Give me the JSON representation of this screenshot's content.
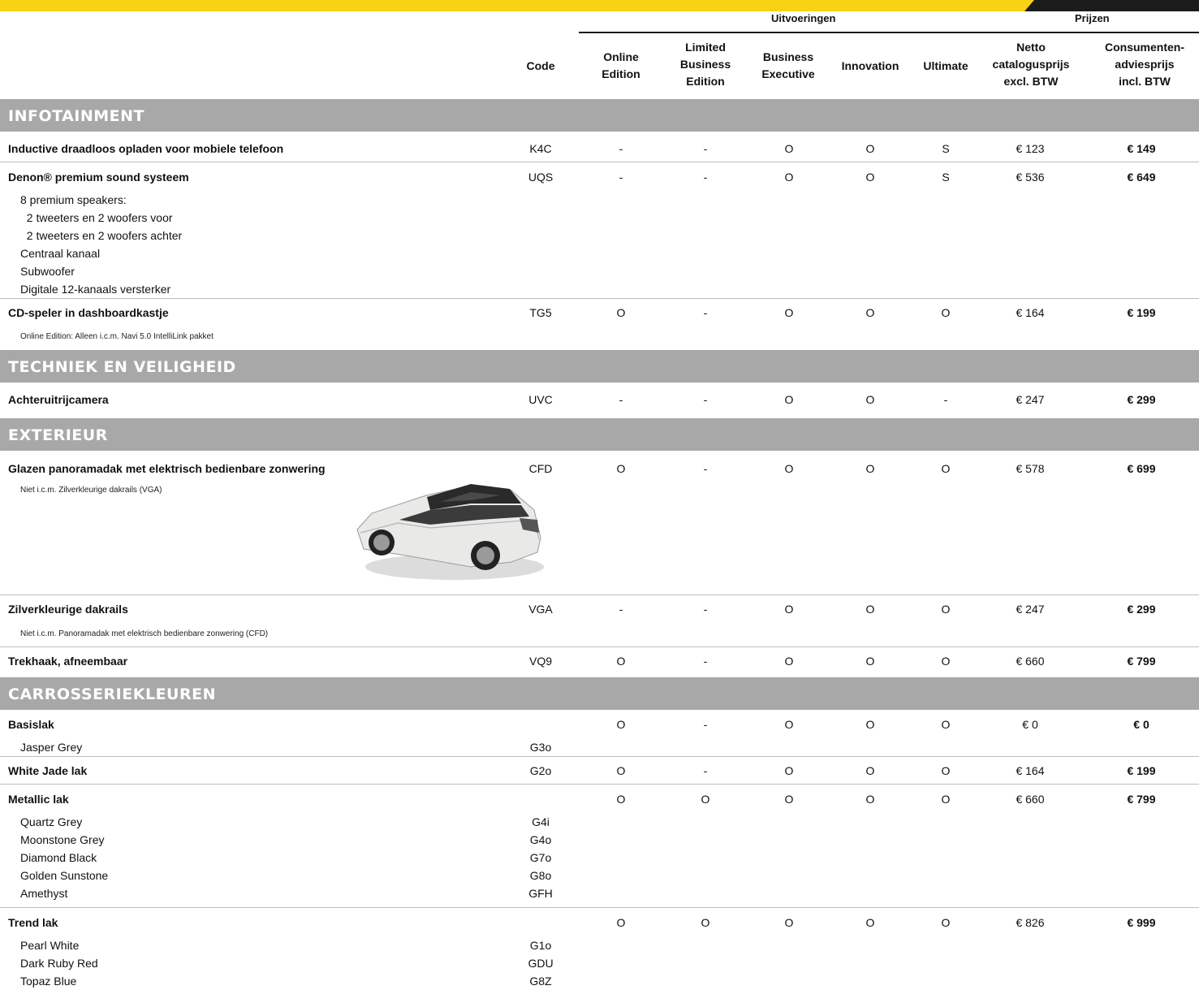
{
  "header": {
    "group_variants": "Uitvoeringen",
    "group_prices": "Prijzen",
    "columns": {
      "code": "Code",
      "online": "Online\nEdition",
      "limited": "Limited\nBusiness\nEdition",
      "business": "Business\nExecutive",
      "innovation": "Innovation",
      "ultimate": "Ultimate",
      "netto": "Netto\ncataloguspr­ijs\nexcl. BTW",
      "consumer": "Consumenten-\nadviesprijs\nincl. BTW"
    }
  },
  "sections": {
    "infotainment": "INFOTAINMENT",
    "techniek": "TECHNIEK EN VEILIGHEID",
    "exterieur": "EXTERIEUR",
    "carrosserie": "CARROSSERIEKLEUREN"
  },
  "rows": {
    "r1": {
      "label": "Inductive draadloos opladen voor mobiele telefoon",
      "code": "K4C",
      "v": [
        "-",
        "-",
        "O",
        "O",
        "S"
      ],
      "netto": "€ 123",
      "consumer": "€ 149"
    },
    "r2": {
      "label": "Denon® premium sound systeem",
      "code": "UQS",
      "v": [
        "-",
        "-",
        "O",
        "O",
        "S"
      ],
      "netto": "€ 536",
      "consumer": "€ 649",
      "sub": "8 premium speakers:\n  2 tweeters en 2 woofers voor\n  2 tweeters en 2 woofers achter\nCentraal kanaal\nSubwoofer\nDigitale 12-kanaals versterker"
    },
    "r3": {
      "label": "CD-speler in dashboardkastje",
      "code": "TG5",
      "v": [
        "O",
        "-",
        "O",
        "O",
        "O"
      ],
      "netto": "€ 164",
      "consumer": "€ 199",
      "note": "Online Edition: Alleen i.c.m. Navi 5.0 IntelliLink pakket"
    },
    "r4": {
      "label": "Achteruitrijcamera",
      "code": "UVC",
      "v": [
        "-",
        "-",
        "O",
        "O",
        "-"
      ],
      "netto": "€ 247",
      "consumer": "€ 299"
    },
    "r5": {
      "label": "Glazen panoramadak met elektrisch bedienbare zonwering",
      "code": "CFD",
      "v": [
        "O",
        "-",
        "O",
        "O",
        "O"
      ],
      "netto": "€ 578",
      "consumer": "€ 699",
      "note": "Niet i.c.m. Zilverkleurige dakrails (VGA)"
    },
    "r6": {
      "label": "Zilverkleurige dakrails",
      "code": "VGA",
      "v": [
        "-",
        "-",
        "O",
        "O",
        "O"
      ],
      "netto": "€ 247",
      "consumer": "€ 299",
      "note": "Niet i.c.m. Panoramadak met elektrisch bedienbare zonwering (CFD)"
    },
    "r7": {
      "label": "Trekhaak, afneembaar",
      "code": "VQ9",
      "v": [
        "O",
        "-",
        "O",
        "O",
        "O"
      ],
      "netto": "€ 660",
      "consumer": "€ 799"
    },
    "r8": {
      "label": "Basislak",
      "code": "",
      "v": [
        "O",
        "-",
        "O",
        "O",
        "O"
      ],
      "netto": "€ 0",
      "consumer": "€ 0",
      "sub": "Jasper Grey",
      "subcode": "G3o"
    },
    "r9": {
      "label": "White Jade lak",
      "code": "G2o",
      "v": [
        "O",
        "-",
        "O",
        "O",
        "O"
      ],
      "netto": "€ 164",
      "consumer": "€ 199"
    },
    "r10": {
      "label": "Metallic lak",
      "code": "",
      "v": [
        "O",
        "O",
        "O",
        "O",
        "O"
      ],
      "netto": "€ 660",
      "consumer": "€ 799",
      "sub": "Quartz Grey\nMoonstone Grey\nDiamond Black\nGolden Sunstone\nAmethyst",
      "subcode": "G4i\nG4o\nG7o\nG8o\nGFH"
    },
    "r11": {
      "label": "Trend lak",
      "code": "",
      "v": [
        "O",
        "O",
        "O",
        "O",
        "O"
      ],
      "netto": "€ 826",
      "consumer": "€ 999",
      "sub": "Pearl White\nDark Ruby Red\nTopaz Blue",
      "subcode": "G1o\nGDU\nG8Z"
    }
  },
  "image_car": "white-suv-with-panoramic-roof"
}
